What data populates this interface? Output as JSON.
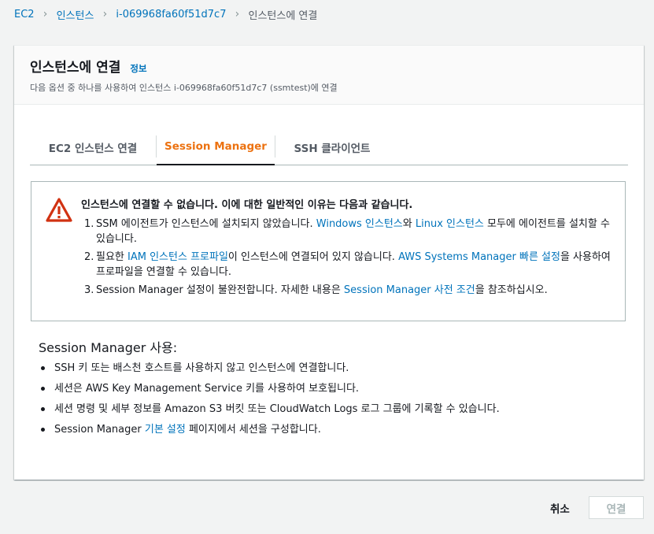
{
  "breadcrumb": {
    "items": [
      "EC2",
      "인스턴스",
      "i-069968fa60f51d7c7",
      "인스턴스에 연결"
    ]
  },
  "panel": {
    "title": "인스턴스에 연결",
    "info_link": "정보",
    "description": "다음 옵션 중 하나를 사용하여 인스턴스 i-069968fa60f51d7c7 (ssmtest)에 연결"
  },
  "tabs": [
    {
      "label": "EC2 인스턴스 연결",
      "active": false
    },
    {
      "label": "Session Manager",
      "active": true
    },
    {
      "label": "SSH 클라이언트",
      "active": false
    }
  ],
  "alert": {
    "icon": "warning-icon",
    "title": "인스턴스에 연결할 수 없습니다. 이에 대한 일반적인 이유는 다음과 같습니다.",
    "item1": {
      "num": "1.",
      "text_a": "SSM 에이전트가 인스턴스에 설치되지 않았습니다. ",
      "link_a": "Windows 인스턴스",
      "text_b": "와 ",
      "link_b": "Linux 인스턴스",
      "text_c": " 모두에 에이전트를 설치할 수 있습니다."
    },
    "item2": {
      "num": "2.",
      "text_a": "필요한 ",
      "link_a": "IAM 인스턴스 프로파일",
      "text_b": "이 인스턴스에 연결되어 있지 않습니다. ",
      "link_b": "AWS Systems Manager 빠른 설정",
      "text_c": "을 사용하여 프로파일을 연결할 수 있습니다."
    },
    "item3": {
      "num": "3.",
      "text_a": "Session Manager 설정이 불완전합니다. 자세한 내용은 ",
      "link_a": "Session Manager 사전 조건",
      "text_b": "을 참조하십시오."
    }
  },
  "usage": {
    "title": "Session Manager 사용:",
    "item1": "SSH 키 또는 배스천 호스트를 사용하지 않고 인스턴스에 연결합니다.",
    "item2": "세션은 AWS Key Management Service 키를 사용하여 보호됩니다.",
    "item3": "세션 명령 및 세부 정보를 Amazon S3 버킷 또는 CloudWatch Logs 로그 그룹에 기록할 수 있습니다.",
    "item4": {
      "text_a": "Session Manager ",
      "link": "기본 설정",
      "text_b": " 페이지에서 세션을 구성합니다."
    }
  },
  "footer": {
    "cancel_label": "취소",
    "connect_label": "연결",
    "connect_enabled": false
  },
  "colors": {
    "link": "#0073bb",
    "active_tab": "#ec7211",
    "warning": "#d13212"
  }
}
